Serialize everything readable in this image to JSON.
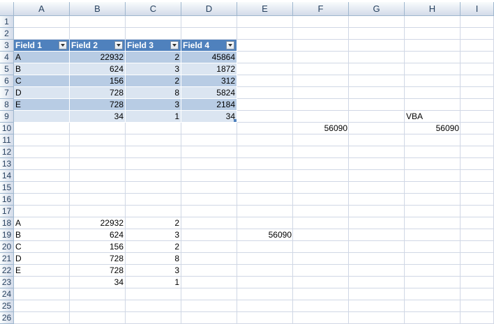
{
  "sheet": {
    "columns": [
      "A",
      "B",
      "C",
      "D",
      "E",
      "F",
      "G",
      "H",
      "I"
    ],
    "rows": [
      "1",
      "2",
      "3",
      "4",
      "5",
      "6",
      "7",
      "8",
      "9",
      "10",
      "11",
      "12",
      "13",
      "14",
      "15",
      "16",
      "17",
      "18",
      "19",
      "20",
      "21",
      "22",
      "23",
      "24",
      "25",
      "26"
    ],
    "table": {
      "headers": [
        "Field 1",
        "Field 2",
        "Field 3",
        "Field 4"
      ],
      "rows": [
        [
          "A",
          "22932",
          "2",
          "45864"
        ],
        [
          "B",
          "624",
          "3",
          "1872"
        ],
        [
          "C",
          "156",
          "2",
          "312"
        ],
        [
          "D",
          "728",
          "8",
          "5824"
        ],
        [
          "E",
          "728",
          "3",
          "2184"
        ],
        [
          "",
          "34",
          "1",
          "34"
        ]
      ],
      "colors": {
        "header": "#4f81bd",
        "band_dark": "#b8cce4",
        "band_light": "#dbe5f1"
      }
    },
    "cells": {
      "H9": "VBA",
      "F10": "56090",
      "H10": "56090",
      "E19": "56090"
    },
    "list": [
      [
        "A",
        "22932",
        "2"
      ],
      [
        "B",
        "624",
        "3"
      ],
      [
        "C",
        "156",
        "2"
      ],
      [
        "D",
        "728",
        "8"
      ],
      [
        "E",
        "728",
        "3"
      ],
      [
        "",
        "34",
        "1"
      ]
    ]
  }
}
